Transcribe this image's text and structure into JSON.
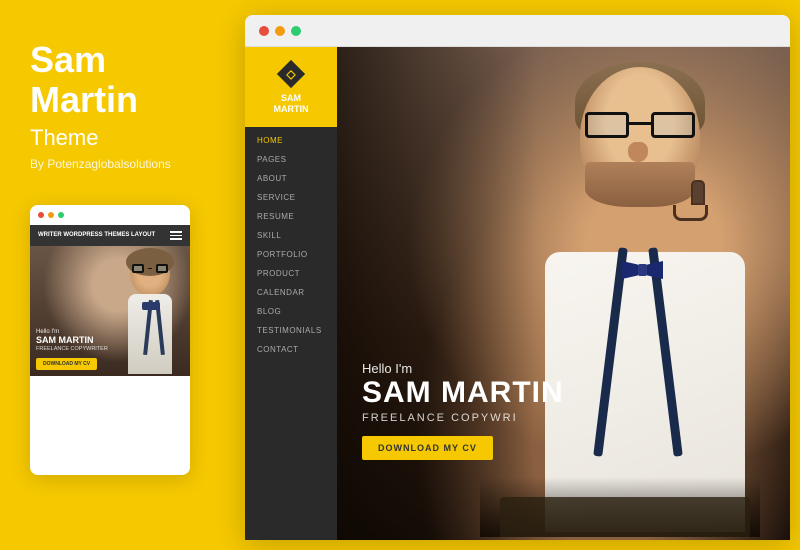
{
  "left": {
    "title_line1": "Sam",
    "title_line2": "Martin",
    "subtitle": "Theme",
    "by": "By Potenzaglobalsolutions"
  },
  "mobile": {
    "header_text": "WRITER WORDPRESS THEMES LAYOUT",
    "hello": "Hello I'm",
    "name_line1": "SAM MARTIN",
    "role": "FREELANCE COPYWRITER",
    "btn": "DOWNLOAD MY CV"
  },
  "browser": {
    "dots": [
      "#E74C3C",
      "#F39C12",
      "#2ECC71"
    ]
  },
  "logo": {
    "name": "SAM\nMARTIN"
  },
  "nav": {
    "items": [
      {
        "label": "HOME",
        "active": true
      },
      {
        "label": "PAGES",
        "active": false
      },
      {
        "label": "ABOUT",
        "active": false
      },
      {
        "label": "SERVICE",
        "active": false
      },
      {
        "label": "RESUME",
        "active": false
      },
      {
        "label": "SKILL",
        "active": false
      },
      {
        "label": "PORTFOLIO",
        "active": false
      },
      {
        "label": "PRODUCT",
        "active": false
      },
      {
        "label": "CALENDAR",
        "active": false
      },
      {
        "label": "BLOG",
        "active": false
      },
      {
        "label": "TESTIMONIALS",
        "active": false
      },
      {
        "label": "CONTACT",
        "active": false
      }
    ]
  },
  "hero": {
    "hello": "Hello I'm",
    "name": "SAM MARTIN",
    "role": "FREELANCE COPYWRI",
    "btn": "DOWNLOAD MY CV"
  }
}
